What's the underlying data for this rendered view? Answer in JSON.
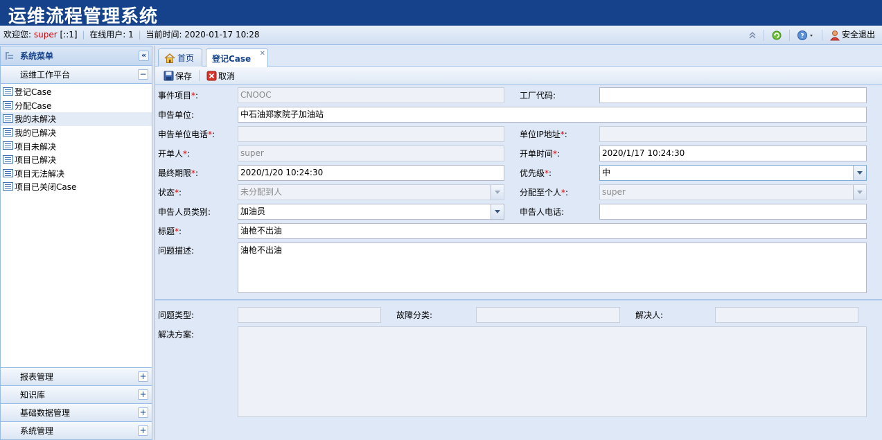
{
  "app": {
    "title": "运维流程管理系统"
  },
  "status": {
    "welcome_label": "欢迎您:",
    "user": "super",
    "ip": "[::1]",
    "online_label": "在线用户:",
    "online_count": "1",
    "time_label": "当前时间:",
    "time_value": "2020-01-17 10:28",
    "logout_label": "安全退出"
  },
  "sidebar": {
    "title": "系统菜单",
    "active_section": "运维工作平台",
    "items": [
      {
        "label": "登记Case"
      },
      {
        "label": "分配Case"
      },
      {
        "label": "我的未解决"
      },
      {
        "label": "我的已解决"
      },
      {
        "label": "项目未解决"
      },
      {
        "label": "项目已解决"
      },
      {
        "label": "项目无法解决"
      },
      {
        "label": "项目已关闭Case"
      }
    ],
    "sections": [
      {
        "label": "报表管理"
      },
      {
        "label": "知识库"
      },
      {
        "label": "基础数据管理"
      },
      {
        "label": "系统管理"
      }
    ]
  },
  "tabs": [
    {
      "label": "首页"
    },
    {
      "label": "登记Case"
    }
  ],
  "toolbar": {
    "save_label": "保存",
    "cancel_label": "取消"
  },
  "form": {
    "event_item": {
      "label": "事件项目",
      "value": "CNOOC"
    },
    "plant_code": {
      "label": "工厂代码:",
      "value": ""
    },
    "reporter_unit": {
      "label": "申告单位:",
      "value": "中石油郑家院子加油站"
    },
    "reporter_phone": {
      "label": "申告单位电话",
      "value": ""
    },
    "unit_ip": {
      "label": "单位IP地址",
      "value": ""
    },
    "opener": {
      "label": "开单人",
      "value": "super"
    },
    "open_time": {
      "label": "开单时间",
      "value": "2020/1/17 10:24:30"
    },
    "deadline": {
      "label": "最终期限",
      "value": "2020/1/20 10:24:30"
    },
    "priority": {
      "label": "优先级",
      "value": "中"
    },
    "state": {
      "label": "状态",
      "value": "未分配到人"
    },
    "assignee": {
      "label": "分配至个人",
      "value": "super"
    },
    "reporter_type": {
      "label": "申告人员类别:",
      "value": "加油员"
    },
    "reporter_tel": {
      "label": "申告人电话:",
      "value": ""
    },
    "subject": {
      "label": "标题",
      "value": "油枪不出油"
    },
    "description": {
      "label": "问题描述:",
      "value": "油枪不出油"
    },
    "problem_type": {
      "label": "问题类型:",
      "value": ""
    },
    "fault_class": {
      "label": "故障分类:",
      "value": ""
    },
    "resolver": {
      "label": "解决人:",
      "value": ""
    },
    "solution": {
      "label": "解决方案:",
      "value": ""
    }
  },
  "required_mark": "*",
  "colon": ":"
}
